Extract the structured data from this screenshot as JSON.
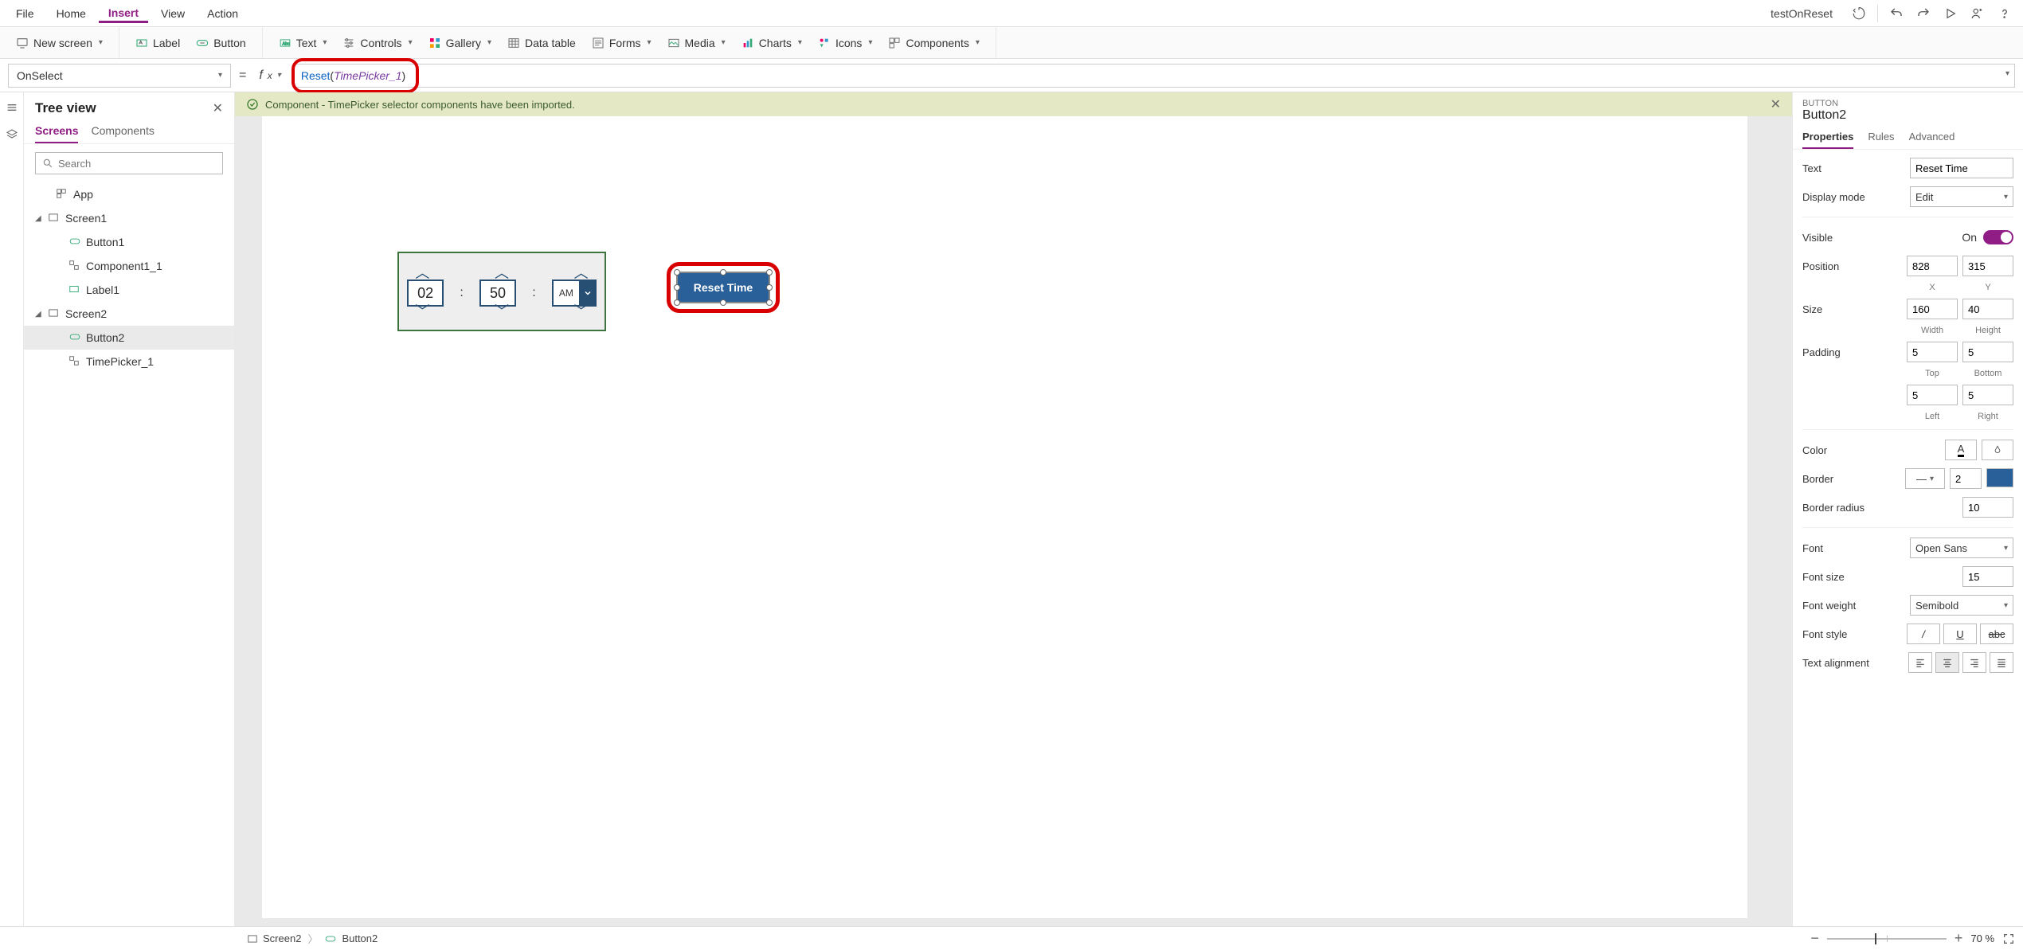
{
  "menu": {
    "items": [
      "File",
      "Home",
      "Insert",
      "View",
      "Action"
    ],
    "active": "Insert"
  },
  "header": {
    "app_name": "testOnReset"
  },
  "ribbon": {
    "new_screen": "New screen",
    "label": "Label",
    "button": "Button",
    "text": "Text",
    "controls": "Controls",
    "gallery": "Gallery",
    "datatable": "Data table",
    "forms": "Forms",
    "media": "Media",
    "charts": "Charts",
    "icons": "Icons",
    "components": "Components"
  },
  "formula": {
    "property": "OnSelect",
    "fn": "Reset",
    "arg": "TimePicker_1"
  },
  "notification": "Component - TimePicker selector components have been imported.",
  "tree": {
    "title": "Tree view",
    "tabs": [
      "Screens",
      "Components"
    ],
    "search_placeholder": "Search",
    "app": "App",
    "items": [
      {
        "name": "Screen1"
      },
      {
        "name": "Button1"
      },
      {
        "name": "Component1_1"
      },
      {
        "name": "Label1"
      },
      {
        "name": "Screen2"
      },
      {
        "name": "Button2"
      },
      {
        "name": "TimePicker_1"
      }
    ]
  },
  "canvas": {
    "timepicker": {
      "hh": "02",
      "mm": "50",
      "ampm": "AM"
    },
    "reset_label": "Reset Time"
  },
  "props": {
    "type": "BUTTON",
    "name": "Button2",
    "tabs": [
      "Properties",
      "Rules",
      "Advanced"
    ],
    "text_label": "Text",
    "text_value": "Reset Time",
    "display_mode_label": "Display mode",
    "display_mode_value": "Edit",
    "visible_label": "Visible",
    "visible_value": "On",
    "position_label": "Position",
    "x": "828",
    "y": "315",
    "x_label": "X",
    "y_label": "Y",
    "size_label": "Size",
    "w": "160",
    "h": "40",
    "w_label": "Width",
    "h_label": "Height",
    "padding_label": "Padding",
    "pt": "5",
    "pb": "5",
    "pl": "5",
    "pr": "5",
    "pt_label": "Top",
    "pb_label": "Bottom",
    "pl_label": "Left",
    "pr_label": "Right",
    "color_label": "Color",
    "border_label": "Border",
    "border_width": "2",
    "border_radius_label": "Border radius",
    "border_radius": "10",
    "font_label": "Font",
    "font_value": "Open Sans",
    "font_size_label": "Font size",
    "font_size": "15",
    "font_weight_label": "Font weight",
    "font_weight": "Semibold",
    "font_style_label": "Font style",
    "text_align_label": "Text alignment"
  },
  "status": {
    "crumb1": "Screen2",
    "crumb2": "Button2",
    "zoom": "70",
    "zoom_suffix": "%"
  }
}
